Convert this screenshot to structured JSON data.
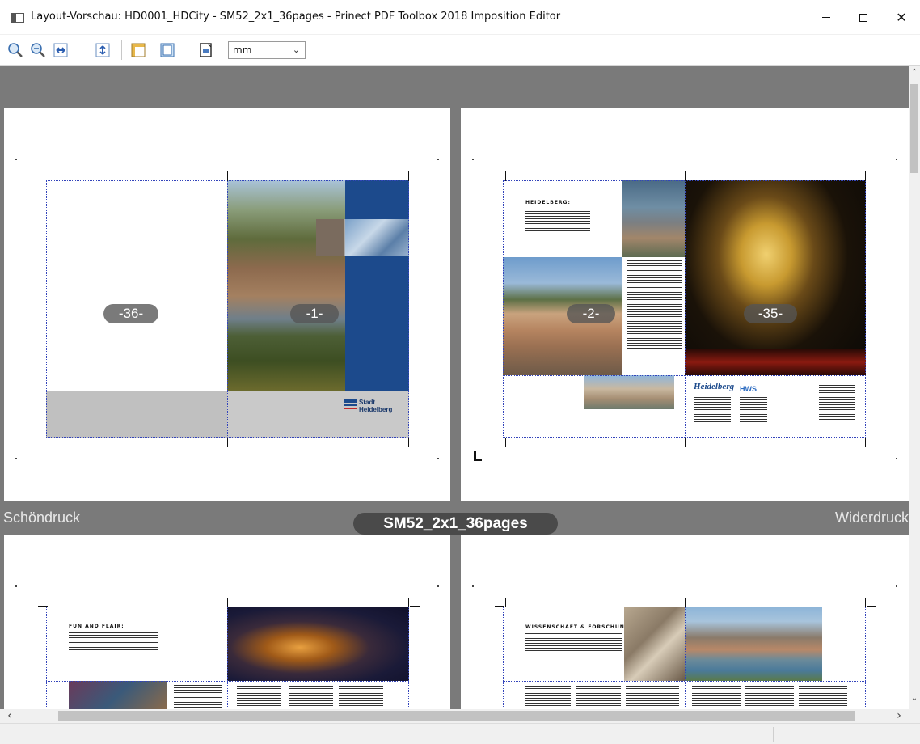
{
  "window": {
    "title": "Layout-Vorschau: HD0001_HDCity - SM52_2x1_36pages - Prinect PDF Toolbox 2018 Imposition Editor",
    "minimize": "—",
    "maximize": "☐",
    "close": "✕"
  },
  "toolbar": {
    "unit_value": "mm",
    "icons": [
      "zoom-in-icon",
      "zoom-out-icon",
      "fit-width-icon",
      "fit-height-icon",
      "margin-guides-icon",
      "page-layout-icon",
      "preview-icon"
    ]
  },
  "sheet": {
    "layout_name": "SM52_2x1_36pages",
    "front_side": "Schöndruck",
    "back_side": "Widerdruck",
    "pages_top": [
      "-36-",
      "-1-",
      "-2-",
      "-35-"
    ]
  },
  "artwork": {
    "stadt_logo_line1": "Stadt",
    "stadt_logo_line2": "Heidelberg",
    "p2_heading": "HEIDELBERG:",
    "p35_logo": "Heidelberg",
    "p35_logo2": "HWS",
    "bottom_left_heading": "FUN AND FLAIR:",
    "bottom_right_heading": "WISSENSCHAFT & FORSCHUNG:"
  },
  "colors": {
    "canvas": "#7a7a7a",
    "trim_line": "#3344bb",
    "cover_blue": "#1c4a8c"
  }
}
